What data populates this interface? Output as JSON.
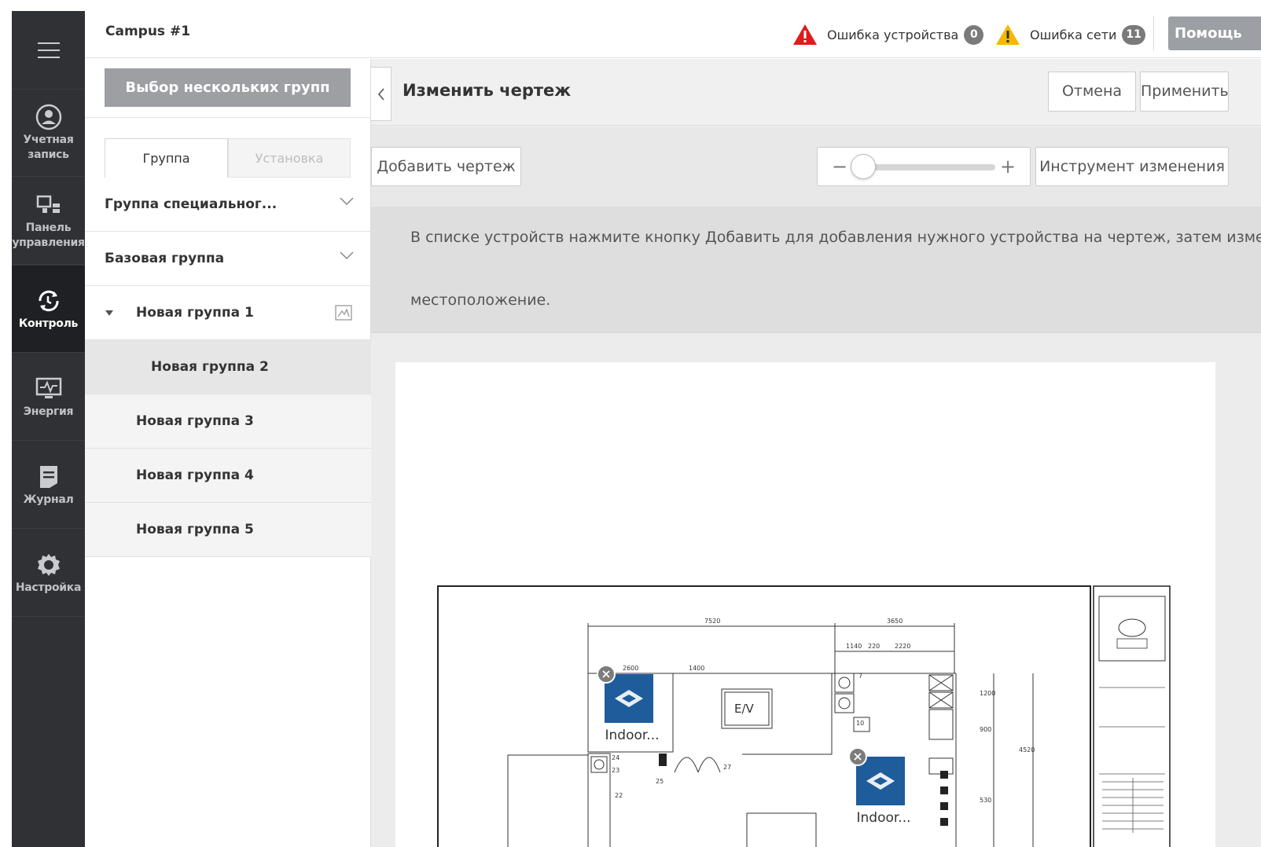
{
  "nav": {
    "items": [
      {
        "label": "Учетная\nзапись",
        "icon": "account-icon"
      },
      {
        "label": "Панель\nуправления",
        "icon": "dashboard-icon"
      },
      {
        "label": "Контроль",
        "icon": "control-icon",
        "active": true
      },
      {
        "label": "Энергия",
        "icon": "energy-icon"
      },
      {
        "label": "Журнал",
        "icon": "log-icon"
      },
      {
        "label": "Настройка",
        "icon": "gear-icon"
      }
    ]
  },
  "header": {
    "title": "Campus #1",
    "device_error_label": "Ошибка устройства",
    "device_error_count": "0",
    "network_error_label": "Ошибка сети",
    "network_error_count": "11",
    "help_label": "Помощь"
  },
  "groups": {
    "multi_select_label": "Выбор нескольких групп",
    "tabs": [
      "Группа",
      "Установка"
    ],
    "rows": [
      "Группа специальног...",
      "Базовая группа",
      "Новая группа 1",
      "Новая группа 2",
      "Новая группа 3",
      "Новая группа 4",
      "Новая группа 5"
    ]
  },
  "editor": {
    "title": "Изменить чертеж",
    "cancel_label": "Отмена",
    "apply_label": "Применить",
    "add_drawing_label": "Добавить чертеж",
    "zoom_level": 0.0,
    "edit_tool_label": "Инструмент изменения",
    "notice_line1": "В списке устройств нажмите кнопку Добавить для добавления нужного устройства на чертеж, затем измените",
    "notice_line2": "местоположение."
  },
  "devices": [
    {
      "name": "Indoor..."
    },
    {
      "name": "Indoor..."
    }
  ],
  "colors": {
    "nav_bg": "#2f3134",
    "nav_active": "#1f2023",
    "device_tile": "#1f5c9c",
    "error_red": "#e01b1b",
    "warning_yellow": "#f5b800"
  }
}
